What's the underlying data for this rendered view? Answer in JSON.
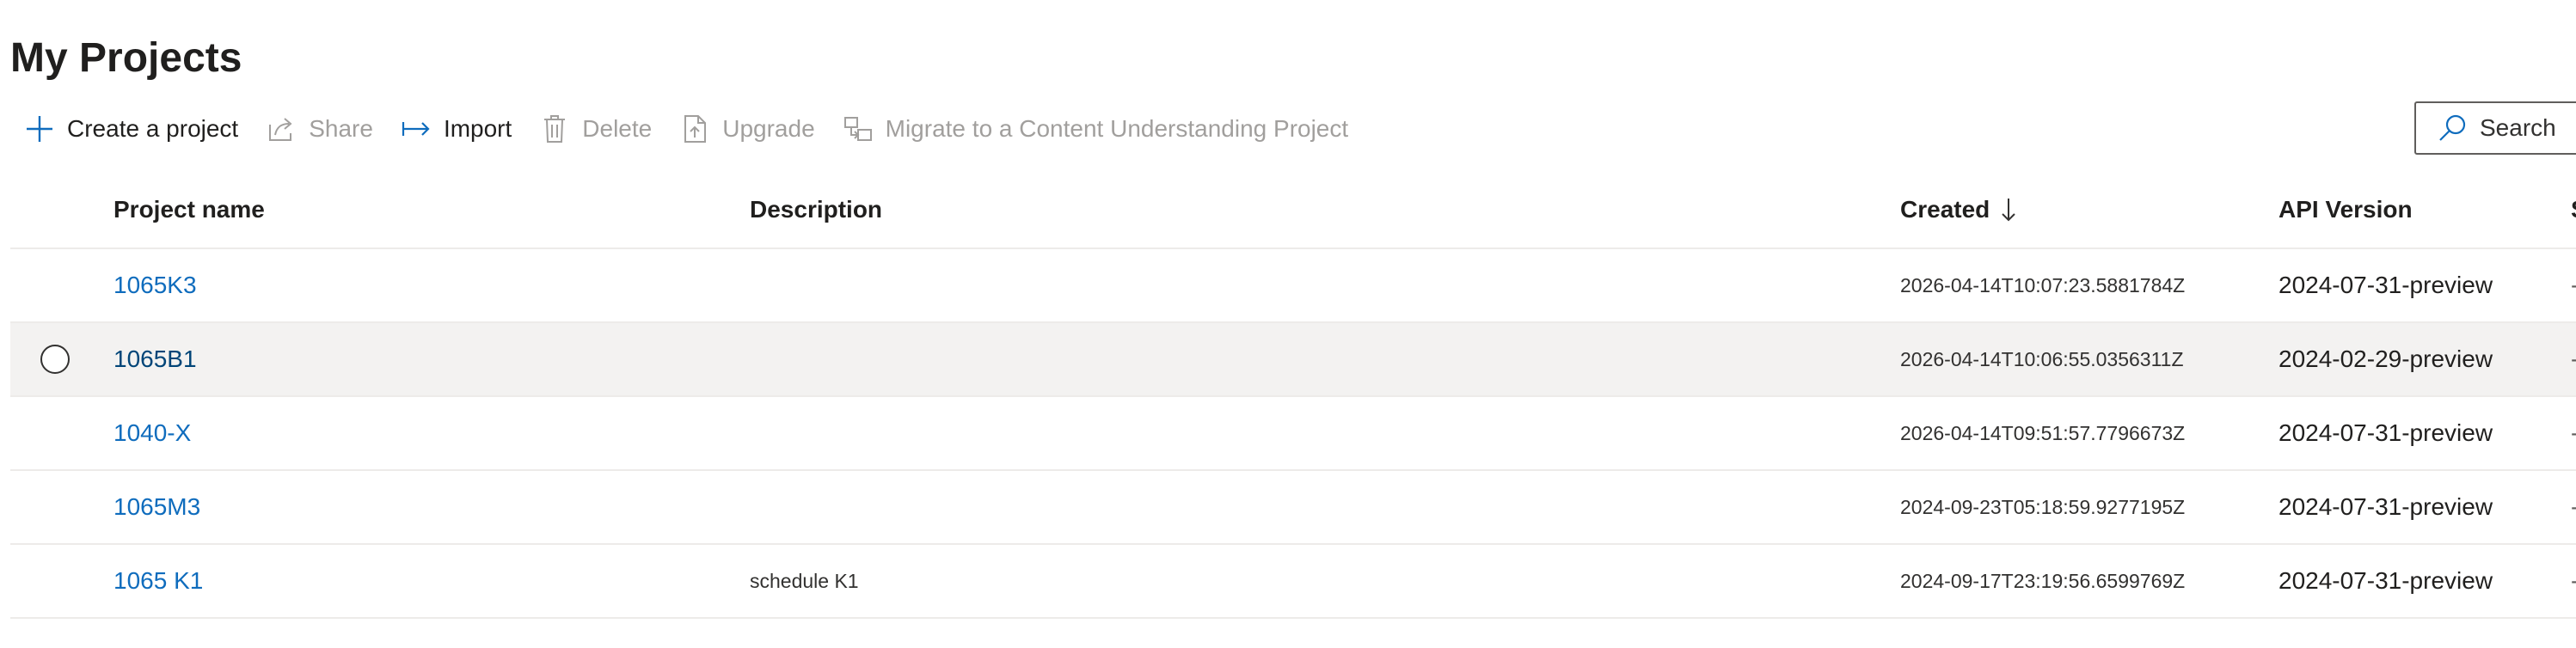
{
  "page": {
    "title": "My Projects"
  },
  "toolbar": {
    "create_label": "Create a project",
    "share_label": "Share",
    "import_label": "Import",
    "delete_label": "Delete",
    "upgrade_label": "Upgrade",
    "migrate_label": "Migrate to a Content Understanding Project",
    "search_label": "Search"
  },
  "columns": {
    "name": "Project name",
    "description": "Description",
    "created": "Created",
    "api_version": "API Version",
    "status_partial": "S"
  },
  "rows": [
    {
      "name": "1065K3",
      "description": "",
      "created": "2026-04-14T10:07:23.5881784Z",
      "api_version": "2024-07-31-preview",
      "status": "-"
    },
    {
      "name": "1065B1",
      "description": "",
      "created": "2026-04-14T10:06:55.0356311Z",
      "api_version": "2024-02-29-preview",
      "status": "-"
    },
    {
      "name": "1040-X",
      "description": "",
      "created": "2026-04-14T09:51:57.7796673Z",
      "api_version": "2024-07-31-preview",
      "status": "-"
    },
    {
      "name": "1065M3",
      "description": "",
      "created": "2024-09-23T05:18:59.9277195Z",
      "api_version": "2024-07-31-preview",
      "status": "-"
    },
    {
      "name": "1065 K1",
      "description": "schedule K1",
      "created": "2024-09-17T23:19:56.6599769Z",
      "api_version": "2024-07-31-preview",
      "status": "-"
    }
  ],
  "colors": {
    "accent": "#0f6cbd",
    "disabled": "#a19f9d",
    "row_hover": "#f3f2f1",
    "divider": "#edebe9"
  },
  "icons": {
    "create": "plus-icon",
    "share": "share-icon",
    "import": "import-arrow-icon",
    "delete": "trash-icon",
    "upgrade": "upgrade-document-icon",
    "migrate": "migrate-icon",
    "search": "search-icon",
    "sort": "sort-down-arrow-icon",
    "row_select": "radio-circle-icon"
  }
}
